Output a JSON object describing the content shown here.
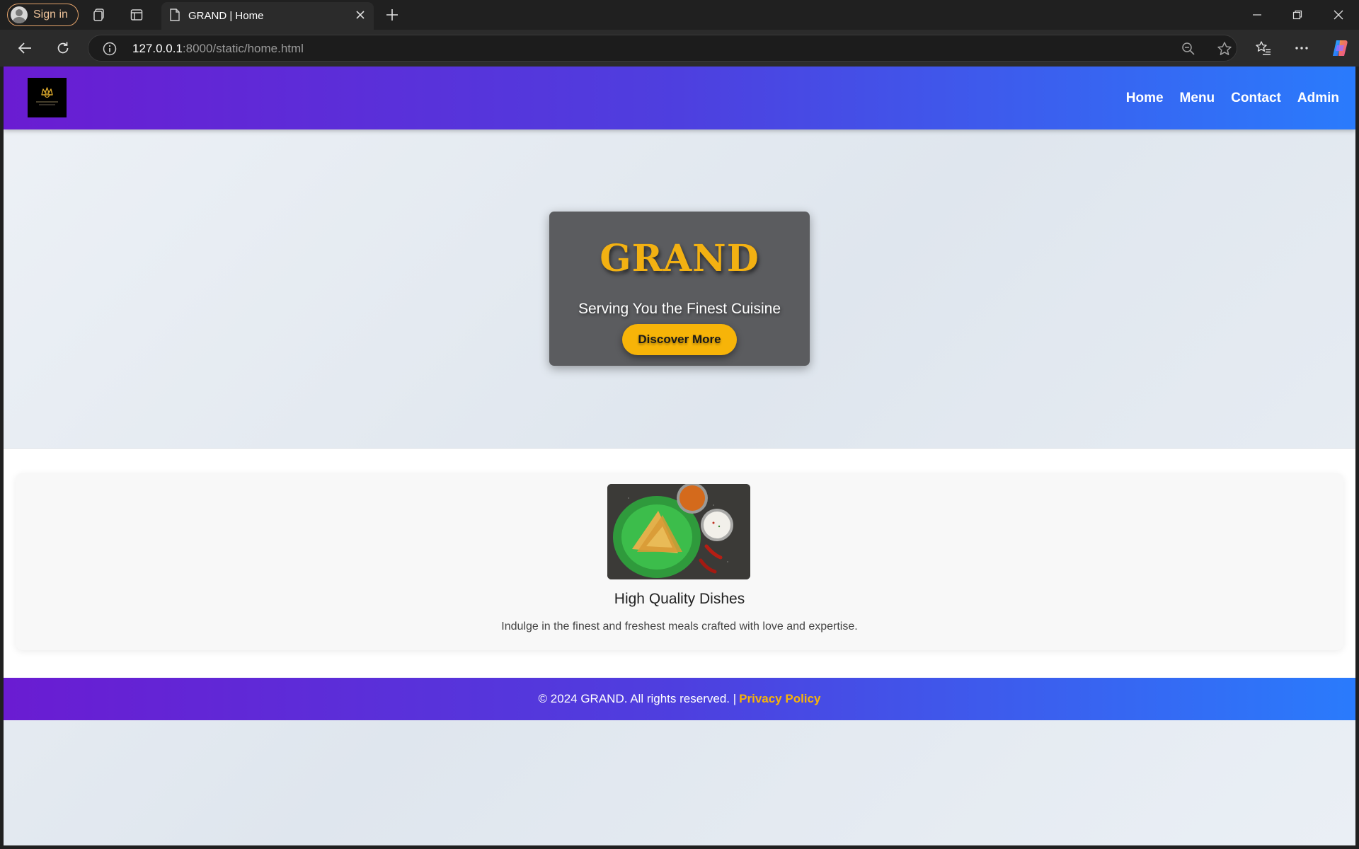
{
  "browser": {
    "signin_label": "Sign in",
    "tab_title": "GRAND | Home",
    "url_host": "127.0.0.1",
    "url_path": ":8000/static/home.html",
    "accent": "#e3a26a"
  },
  "nav": {
    "links": [
      "Home",
      "Menu",
      "Contact",
      "Admin"
    ]
  },
  "hero": {
    "title": "GRAND",
    "subtitle": "Serving You the Finest Cuisine",
    "button_label": "Discover More",
    "title_color": "#f3b112",
    "button_color": "#f7b408"
  },
  "feature": {
    "title": "High Quality Dishes",
    "description": "Indulge in the finest and freshest meals crafted with love and expertise."
  },
  "footer": {
    "copyright": "© 2024 GRAND. All rights reserved. |",
    "privacy_label": "Privacy Policy"
  },
  "theme": {
    "gradient_start": "#6a1cd2",
    "gradient_end": "#2a7bfc"
  }
}
